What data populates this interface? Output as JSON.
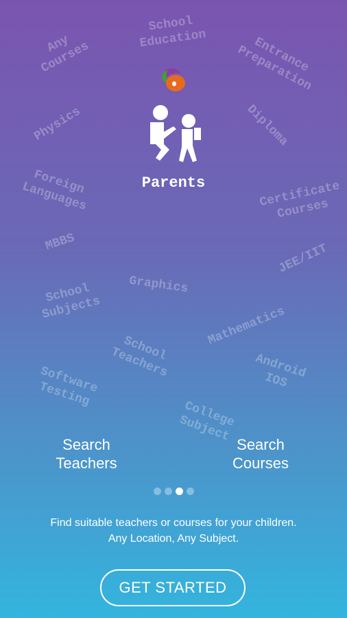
{
  "background_words": [
    "Any\nCourses",
    "School\nEducation",
    "Entrance\nPreparation",
    "Physics",
    "Diploma",
    "Foreign\nLanguages",
    "Certificate\nCourses",
    "MBBS",
    "JEE/IIT",
    "School\nSubjects",
    "Graphics",
    "Mathematics",
    "School\nTeachers",
    "Software\nTesting",
    "Android\nIOS",
    "College\nSubject"
  ],
  "hero": {
    "title": "Parents"
  },
  "actions": {
    "search_teachers": "Search\nTeachers",
    "search_courses": "Search\nCourses"
  },
  "pager": {
    "count": 4,
    "active_index": 2
  },
  "tagline": {
    "line1": "Find suitable teachers or courses for your children.",
    "line2": "Any Location, Any Subject."
  },
  "cta": {
    "label": "GET STARTED"
  },
  "colors": {
    "gradient_top": "#7a55b0",
    "gradient_bottom": "#33b5de",
    "logo_orange": "#e86a1f",
    "logo_purple": "#8a3fa0",
    "logo_green": "#4a9a3a"
  }
}
